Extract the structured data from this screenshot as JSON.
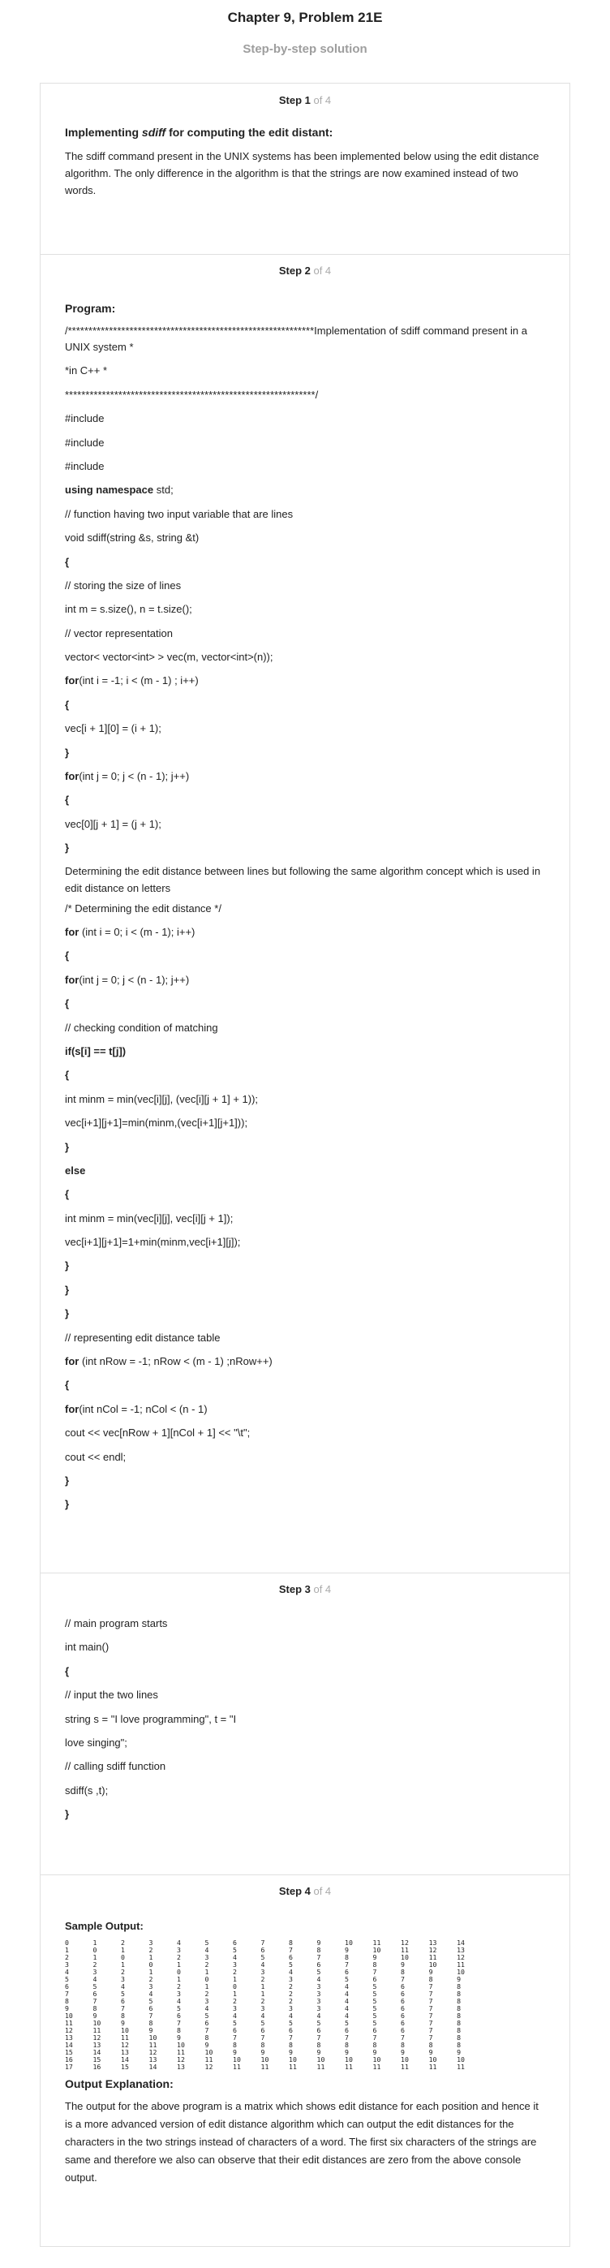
{
  "header": {
    "title": "Chapter 9, Problem 21E",
    "subtitle": "Step-by-step solution"
  },
  "steps": [
    {
      "label": "Step 1",
      "of": " of 4",
      "title_prefix": "Implementing ",
      "title_em": "sdiff",
      "title_suffix": " for computing the edit distant:",
      "text": "The sdiff command present in the UNIX systems has been implemented below using the edit distance algorithm. The only difference in the algorithm is that the strings are now examined instead of two words."
    },
    {
      "label": "Step 2",
      "of": " of 4",
      "title": "Program:",
      "lines": [
        {
          "t": "/************************************************************Implementation of sdiff command present in a UNIX system *",
          "b": false
        },
        {
          "t": "*in C++ *",
          "b": false
        },
        {
          "t": "*************************************************************/",
          "b": false
        },
        {
          "t": "#include",
          "b": false
        },
        {
          "t": "#include",
          "b": false
        },
        {
          "t": "#include",
          "b": false
        },
        {
          "t": "using namespace std;",
          "b": "partial",
          "bold": "using namespace",
          "rest": " std;"
        },
        {
          "t": "// function having two input variable that are lines",
          "b": false
        },
        {
          "t": "void sdiff(string &s, string &t)",
          "b": false
        },
        {
          "t": "{",
          "b": true
        },
        {
          "t": "// storing the size of lines",
          "b": false
        },
        {
          "t": "int m = s.size(), n = t.size();",
          "b": false
        },
        {
          "t": "// vector representation",
          "b": false
        },
        {
          "t": "vector< vector<int> > vec(m, vector<int>(n));",
          "b": false
        },
        {
          "t": "for(int i = -1; i < (m - 1) ; i++)",
          "b": "partial",
          "bold": "for",
          "rest": "(int i = -1; i < (m - 1) ; i++)"
        },
        {
          "t": "{",
          "b": true
        },
        {
          "t": "vec[i + 1][0] = (i + 1);",
          "b": false
        },
        {
          "t": "}",
          "b": true
        },
        {
          "t": "for(int j = 0; j < (n - 1); j++)",
          "b": "partial",
          "bold": "for",
          "rest": "(int j = 0; j < (n - 1); j++)"
        },
        {
          "t": "{",
          "b": true
        },
        {
          "t": "vec[0][j + 1] = (j + 1);",
          "b": false
        },
        {
          "t": "}",
          "b": true
        }
      ],
      "para": "Determining the edit distance between lines but following the same algorithm concept which is used in edit distance on letters",
      "lines2": [
        {
          "t": "/* Determining the edit distance */",
          "b": false
        },
        {
          "t": "for (int i = 0; i < (m - 1); i++)",
          "b": "partial",
          "bold": "for",
          "rest": " (int i = 0; i < (m - 1); i++)"
        },
        {
          "t": "{",
          "b": true
        },
        {
          "t": "for(int j = 0; j < (n - 1); j++)",
          "b": "partial",
          "bold": "for",
          "rest": "(int j = 0; j < (n - 1); j++)"
        },
        {
          "t": "{",
          "b": true
        },
        {
          "t": "// checking condition of matching",
          "b": false
        },
        {
          "t": "if(s[i] == t[j])",
          "b": true
        },
        {
          "t": "{",
          "b": true
        },
        {
          "t": "int minm = min(vec[i][j], (vec[i][j + 1] + 1));",
          "b": false
        },
        {
          "t": "vec[i+1][j+1]=min(minm,(vec[i+1][j+1]));",
          "b": false
        },
        {
          "t": "}",
          "b": true
        },
        {
          "t": "else",
          "b": true
        },
        {
          "t": "{",
          "b": true
        },
        {
          "t": "int minm = min(vec[i][j], vec[i][j + 1]);",
          "b": false
        },
        {
          "t": "vec[i+1][j+1]=1+min(minm,vec[i+1][j]);",
          "b": false
        },
        {
          "t": "}",
          "b": true
        },
        {
          "t": "}",
          "b": true
        },
        {
          "t": "}",
          "b": true
        },
        {
          "t": "// representing edit distance table",
          "b": false
        },
        {
          "t": "for (int nRow = -1; nRow < (m - 1) ;nRow++)",
          "b": "partial",
          "bold": "for",
          "rest": " (int nRow = -1; nRow < (m - 1) ;nRow++)"
        },
        {
          "t": "{",
          "b": true
        },
        {
          "t": "for(int nCol = -1; nCol < (n - 1)",
          "b": "partial",
          "bold": "for",
          "rest": "(int nCol = -1; nCol < (n - 1)"
        },
        {
          "t": "cout << vec[nRow + 1][nCol + 1] << \"\\t\";",
          "b": false
        },
        {
          "t": "cout << endl;",
          "b": false
        },
        {
          "t": "}",
          "b": true
        },
        {
          "t": "}",
          "b": true
        }
      ]
    },
    {
      "label": "Step 3",
      "of": " of 4",
      "lines": [
        {
          "t": "// main program starts",
          "b": false
        },
        {
          "t": "int main()",
          "b": false
        },
        {
          "t": "{",
          "b": true
        },
        {
          "t": "// input the two lines",
          "b": false
        },
        {
          "t": "string s = \"I love programming\", t = \"I",
          "b": false
        },
        {
          "t": "love singing\";",
          "b": false
        },
        {
          "t": "// calling sdiff function",
          "b": false
        },
        {
          "t": "sdiff(s ,t);",
          "b": false
        },
        {
          "t": "}",
          "b": true
        }
      ]
    },
    {
      "label": "Step 4",
      "of": " of 4",
      "sample_title": "Sample Output:",
      "matrix": [
        [
          0,
          1,
          2,
          3,
          4,
          5,
          6,
          7,
          8,
          9,
          10,
          11,
          12,
          13,
          14
        ],
        [
          1,
          0,
          1,
          2,
          3,
          4,
          5,
          6,
          7,
          8,
          9,
          10,
          11,
          12,
          13
        ],
        [
          2,
          1,
          0,
          1,
          2,
          3,
          4,
          5,
          6,
          7,
          8,
          9,
          10,
          11,
          12
        ],
        [
          3,
          2,
          1,
          0,
          1,
          2,
          3,
          4,
          5,
          6,
          7,
          8,
          9,
          10,
          11
        ],
        [
          4,
          3,
          2,
          1,
          0,
          1,
          2,
          3,
          4,
          5,
          6,
          7,
          8,
          9,
          10
        ],
        [
          5,
          4,
          3,
          2,
          1,
          0,
          1,
          2,
          3,
          4,
          5,
          6,
          7,
          8,
          9
        ],
        [
          6,
          5,
          4,
          3,
          2,
          1,
          0,
          1,
          2,
          3,
          4,
          5,
          6,
          7,
          8
        ],
        [
          7,
          6,
          5,
          4,
          3,
          2,
          1,
          1,
          2,
          3,
          4,
          5,
          6,
          7,
          8
        ],
        [
          8,
          7,
          6,
          5,
          4,
          3,
          2,
          2,
          2,
          3,
          4,
          5,
          6,
          7,
          8
        ],
        [
          9,
          8,
          7,
          6,
          5,
          4,
          3,
          3,
          3,
          3,
          4,
          5,
          6,
          7,
          8
        ],
        [
          10,
          9,
          8,
          7,
          6,
          5,
          4,
          4,
          4,
          4,
          4,
          5,
          6,
          7,
          8
        ],
        [
          11,
          10,
          9,
          8,
          7,
          6,
          5,
          5,
          5,
          5,
          5,
          5,
          6,
          7,
          8
        ],
        [
          12,
          11,
          10,
          9,
          8,
          7,
          6,
          6,
          6,
          6,
          6,
          6,
          6,
          7,
          8
        ],
        [
          13,
          12,
          11,
          10,
          9,
          8,
          7,
          7,
          7,
          7,
          7,
          7,
          7,
          7,
          8
        ],
        [
          14,
          13,
          12,
          11,
          10,
          9,
          8,
          8,
          8,
          8,
          8,
          8,
          8,
          8,
          8
        ],
        [
          15,
          14,
          13,
          12,
          11,
          10,
          9,
          9,
          9,
          9,
          9,
          9,
          9,
          9,
          9
        ],
        [
          16,
          15,
          14,
          13,
          12,
          11,
          10,
          10,
          10,
          10,
          10,
          10,
          10,
          10,
          10
        ],
        [
          17,
          16,
          15,
          14,
          13,
          12,
          11,
          11,
          11,
          11,
          11,
          11,
          11,
          11,
          11
        ]
      ],
      "expl_title": "Output Explanation:",
      "text": "The output for the above program is a matrix which shows edit distance for each position and hence it is a more advanced version of edit distance algorithm which can output the edit distances for the characters in the two strings instead of characters of a word. The first six characters of the strings are same and therefore we also can observe that their edit distances are zero from the above console output."
    }
  ]
}
